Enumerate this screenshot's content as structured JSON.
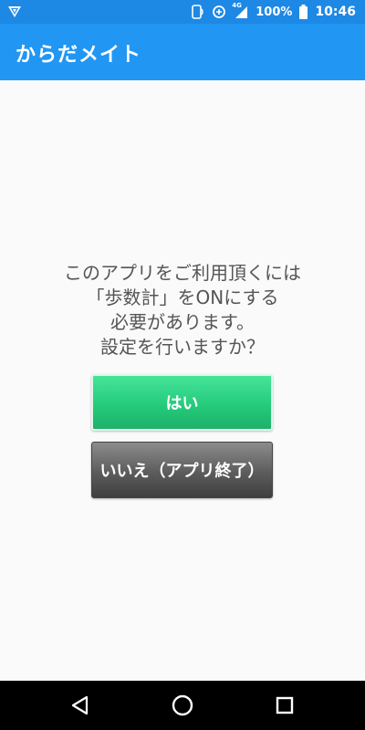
{
  "status_bar": {
    "battery_percent": "100%",
    "time": "10:46",
    "network_type": "4G",
    "icons": [
      "app-notification-icon",
      "nfc-icon",
      "data-saver-icon",
      "signal-icon",
      "battery-icon"
    ]
  },
  "app_bar": {
    "title": "からだメイト"
  },
  "dialog": {
    "message_lines": [
      "このアプリをご利用頂くには",
      "「歩数計」をONにする",
      "必要があります。",
      "設定を行いますか？"
    ],
    "yes_label": "はい",
    "no_label": "いいえ（アプリ終了）"
  },
  "nav_bar": {
    "icons": [
      "back-icon",
      "home-icon",
      "recents-icon"
    ]
  },
  "colors": {
    "app_bar": "#2196f3",
    "status_bar": "#1e88e5",
    "yes_button": "#23c978",
    "no_button": "#5c5c5c"
  }
}
